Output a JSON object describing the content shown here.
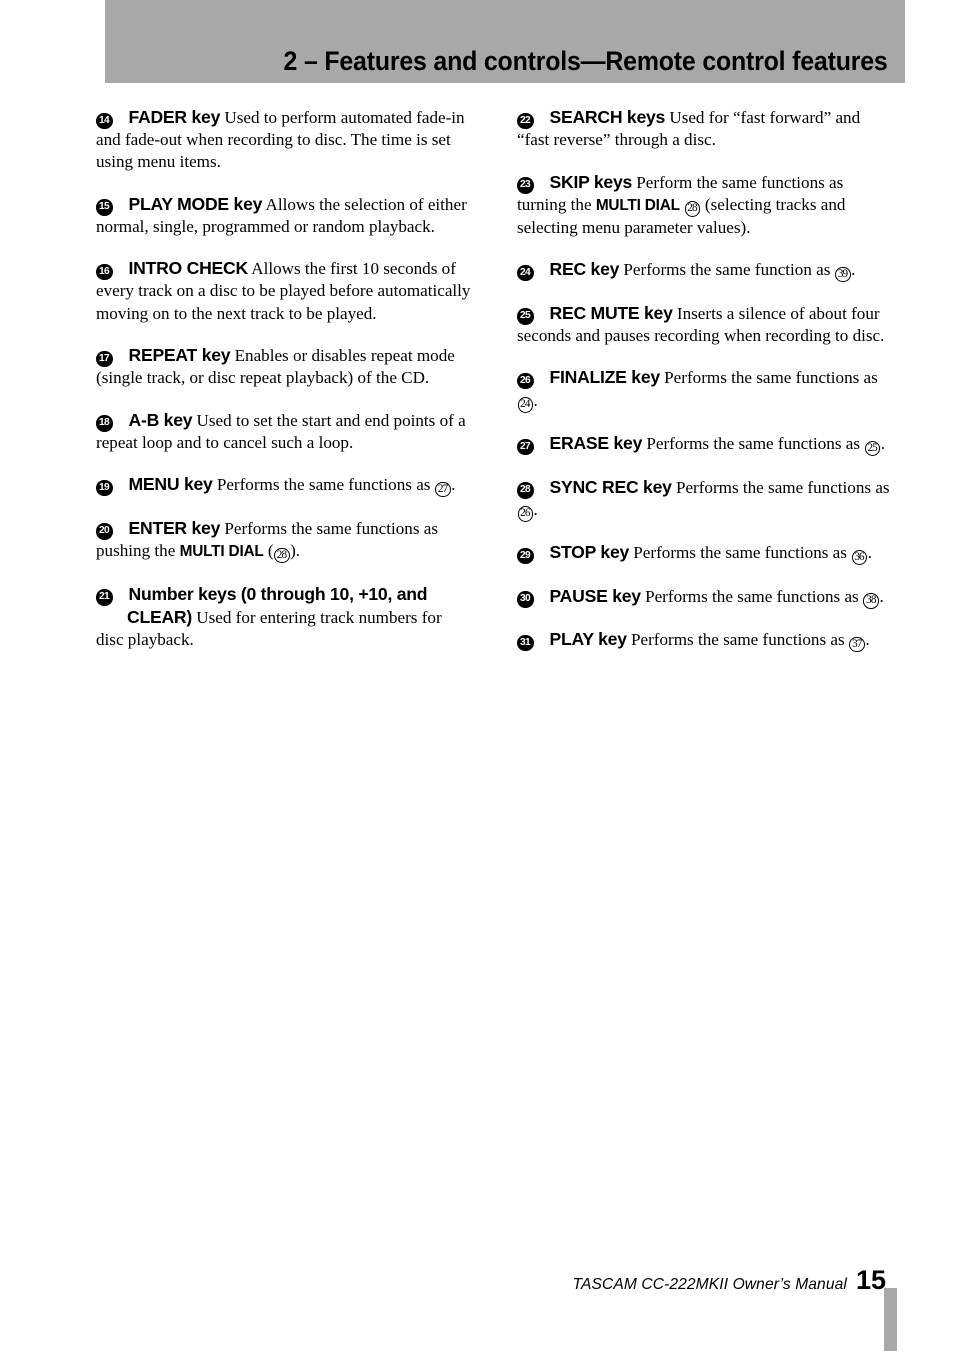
{
  "header": {
    "title": "2 – Features and controls—Remote control features",
    "background_color": "#a8a8a8"
  },
  "columns": {
    "left": [
      {
        "marker": "14",
        "key_name": "FADER key",
        "text": " Used to perform automated fade-in and fade-out when recording to disc. The time is set using menu items."
      },
      {
        "marker": "15",
        "key_name": "PLAY MODE key",
        "text": " Allows the selection of either normal, single, programmed or random playback."
      },
      {
        "marker": "16",
        "key_name": "INTRO CHECK",
        "text": " Allows the first 10 seconds of every track on a disc to be played before automatically moving on to the next track to be played."
      },
      {
        "marker": "17",
        "key_name": "REPEAT key",
        "text": " Enables or disables repeat mode (single track, or disc repeat playback) of the CD."
      },
      {
        "marker": "18",
        "key_name": "A-B key",
        "text": " Used to set the start and end points of a repeat loop and to cancel such a loop."
      },
      {
        "marker": "19",
        "key_name": "MENU key",
        "text_before": " Performs the same functions as ",
        "ref": "27",
        "text_after": "."
      },
      {
        "marker": "20",
        "key_name": "ENTER key",
        "text_before": " Performs the same functions as pushing the ",
        "inline_bold": "MULTI DIAL",
        "text_mid": " (",
        "ref": "28",
        "text_after": ")."
      },
      {
        "marker": "21",
        "key_name_line1": "Number keys (0 through 10, +10, and",
        "key_name_line2": "CLEAR)",
        "text": " Used for entering track numbers for disc playback."
      }
    ],
    "right": [
      {
        "marker": "22",
        "key_name": "SEARCH keys",
        "text": " Used for “fast forward” and “fast reverse” through a disc."
      },
      {
        "marker": "23",
        "key_name": "SKIP keys",
        "text_before": " Perform the same functions as turning the ",
        "inline_bold": "MULTI DIAL",
        "text_mid": " ",
        "ref": "28",
        "text_after": " (selecting tracks and selecting menu parameter values)."
      },
      {
        "marker": "24",
        "key_name": "REC key",
        "text_before": " Performs the same function as ",
        "ref": "39",
        "text_after": "."
      },
      {
        "marker": "25",
        "key_name": "REC MUTE key",
        "text": " Inserts a silence of about four seconds and pauses recording when recording to disc."
      },
      {
        "marker": "26",
        "key_name": "FINALIZE key",
        "text_before": " Performs the same functions as ",
        "ref": "24",
        "text_after": "."
      },
      {
        "marker": "27",
        "key_name": "ERASE key",
        "text_before": " Performs the same functions as ",
        "ref": "25",
        "text_after": "."
      },
      {
        "marker": "28",
        "key_name": "SYNC REC key",
        "text_before": " Performs the same functions as ",
        "ref": "26",
        "text_after": "."
      },
      {
        "marker": "29",
        "key_name": "STOP key",
        "text_before": " Performs the same functions as ",
        "ref": "36",
        "text_after": "."
      },
      {
        "marker": "30",
        "key_name": "PAUSE key",
        "text_before": " Performs the same functions as ",
        "ref": "38",
        "text_after": "."
      },
      {
        "marker": "31",
        "key_name": "PLAY key",
        "text_before": " Performs the same functions as ",
        "ref": "37",
        "text_after": "."
      }
    ]
  },
  "footer": {
    "text": "TASCAM CC-222MKII Owner’s Manual",
    "page_number": "15"
  }
}
